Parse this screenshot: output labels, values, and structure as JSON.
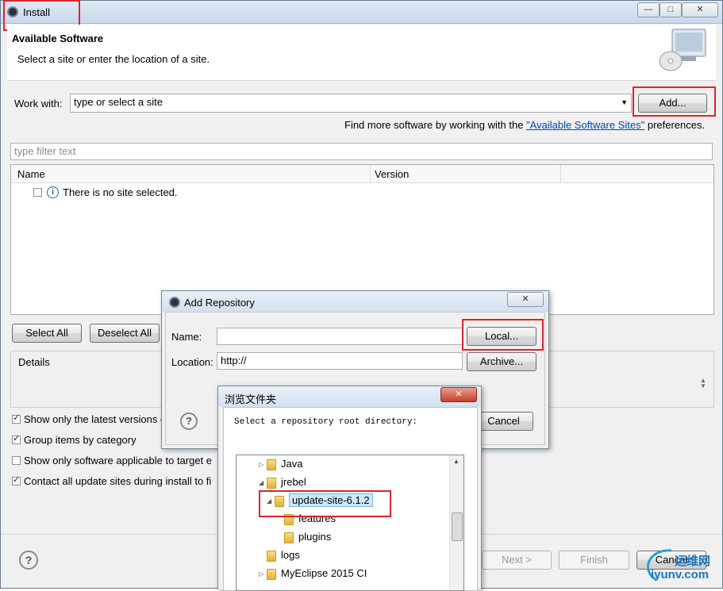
{
  "window": {
    "title": "Install",
    "min": "—",
    "max": "□",
    "close": "✕"
  },
  "header": {
    "title": "Available Software",
    "subtitle": "Select a site or enter the location of a site."
  },
  "work_with": {
    "label": "Work with:",
    "value": "type or select a site",
    "add_button": "Add..."
  },
  "find_more": {
    "prefix": "Find more software by working with the ",
    "link": "\"Available Software Sites\"",
    "suffix": " preferences."
  },
  "filter": {
    "placeholder": "type filter text"
  },
  "table": {
    "columns": [
      "Name",
      "Version"
    ],
    "empty_message": "There is no site selected."
  },
  "buttons": {
    "select_all": "Select All",
    "deselect_all": "Deselect All",
    "next": "Next >",
    "finish": "Finish",
    "cancel": "Cancel"
  },
  "details": {
    "label": "Details"
  },
  "options": [
    {
      "label": "Show only the latest versions o",
      "checked": true
    },
    {
      "label": "Group items by category",
      "checked": true
    },
    {
      "label": "Show only software applicable to target e",
      "checked": false
    },
    {
      "label": "Contact all update sites during install to fi",
      "checked": true
    }
  ],
  "add_repo": {
    "title": "Add Repository",
    "close": "✕",
    "name_label": "Name:",
    "name_value": "",
    "location_label": "Location:",
    "location_value": "http://",
    "local_button": "Local...",
    "archive_button": "Archive...",
    "cancel_button": "Cancel"
  },
  "browse": {
    "title": "浏览文件夹",
    "close": "✕",
    "prompt": "Select a repository root directory:",
    "tree": [
      {
        "label": "Java",
        "expander": "▷"
      },
      {
        "label": "jrebel",
        "expander": "◢"
      },
      {
        "label": "update-site-6.1.2",
        "expander": "◢",
        "selected": true
      },
      {
        "label": "features",
        "expander": ""
      },
      {
        "label": "plugins",
        "expander": ""
      },
      {
        "label": "logs",
        "expander": ""
      },
      {
        "label": "MyEclipse 2015 CI",
        "expander": "▷"
      }
    ]
  },
  "watermark": {
    "site_cn": "运维网",
    "site_url": "iyunv.com"
  },
  "colors": {
    "link": "#0645ad",
    "highlight_red": "#d9262e",
    "selection": "#cce8ff"
  }
}
